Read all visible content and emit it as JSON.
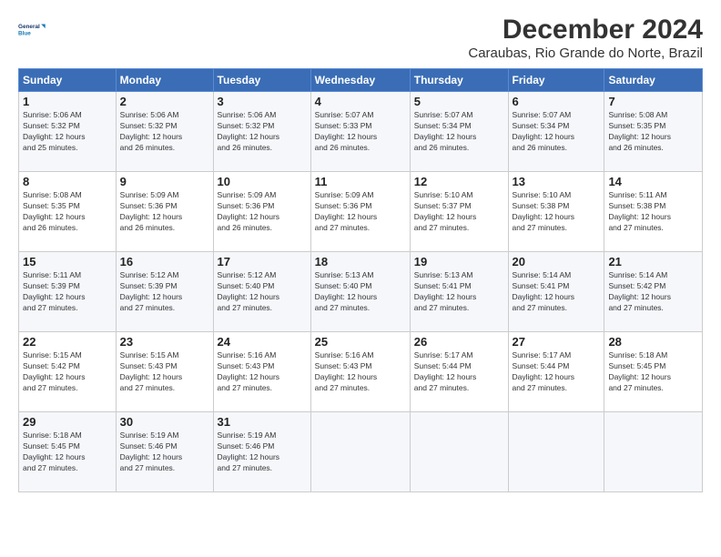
{
  "header": {
    "logo_line1": "General",
    "logo_line2": "Blue",
    "title": "December 2024",
    "subtitle": "Caraubas, Rio Grande do Norte, Brazil"
  },
  "calendar": {
    "days_of_week": [
      "Sunday",
      "Monday",
      "Tuesday",
      "Wednesday",
      "Thursday",
      "Friday",
      "Saturday"
    ],
    "weeks": [
      [
        {
          "day": "",
          "info": ""
        },
        {
          "day": "2",
          "info": "Sunrise: 5:06 AM\nSunset: 5:32 PM\nDaylight: 12 hours\nand 26 minutes."
        },
        {
          "day": "3",
          "info": "Sunrise: 5:06 AM\nSunset: 5:32 PM\nDaylight: 12 hours\nand 26 minutes."
        },
        {
          "day": "4",
          "info": "Sunrise: 5:07 AM\nSunset: 5:33 PM\nDaylight: 12 hours\nand 26 minutes."
        },
        {
          "day": "5",
          "info": "Sunrise: 5:07 AM\nSunset: 5:34 PM\nDaylight: 12 hours\nand 26 minutes."
        },
        {
          "day": "6",
          "info": "Sunrise: 5:07 AM\nSunset: 5:34 PM\nDaylight: 12 hours\nand 26 minutes."
        },
        {
          "day": "7",
          "info": "Sunrise: 5:08 AM\nSunset: 5:35 PM\nDaylight: 12 hours\nand 26 minutes."
        }
      ],
      [
        {
          "day": "8",
          "info": "Sunrise: 5:08 AM\nSunset: 5:35 PM\nDaylight: 12 hours\nand 26 minutes."
        },
        {
          "day": "9",
          "info": "Sunrise: 5:09 AM\nSunset: 5:36 PM\nDaylight: 12 hours\nand 26 minutes."
        },
        {
          "day": "10",
          "info": "Sunrise: 5:09 AM\nSunset: 5:36 PM\nDaylight: 12 hours\nand 26 minutes."
        },
        {
          "day": "11",
          "info": "Sunrise: 5:09 AM\nSunset: 5:36 PM\nDaylight: 12 hours\nand 27 minutes."
        },
        {
          "day": "12",
          "info": "Sunrise: 5:10 AM\nSunset: 5:37 PM\nDaylight: 12 hours\nand 27 minutes."
        },
        {
          "day": "13",
          "info": "Sunrise: 5:10 AM\nSunset: 5:38 PM\nDaylight: 12 hours\nand 27 minutes."
        },
        {
          "day": "14",
          "info": "Sunrise: 5:11 AM\nSunset: 5:38 PM\nDaylight: 12 hours\nand 27 minutes."
        }
      ],
      [
        {
          "day": "15",
          "info": "Sunrise: 5:11 AM\nSunset: 5:39 PM\nDaylight: 12 hours\nand 27 minutes."
        },
        {
          "day": "16",
          "info": "Sunrise: 5:12 AM\nSunset: 5:39 PM\nDaylight: 12 hours\nand 27 minutes."
        },
        {
          "day": "17",
          "info": "Sunrise: 5:12 AM\nSunset: 5:40 PM\nDaylight: 12 hours\nand 27 minutes."
        },
        {
          "day": "18",
          "info": "Sunrise: 5:13 AM\nSunset: 5:40 PM\nDaylight: 12 hours\nand 27 minutes."
        },
        {
          "day": "19",
          "info": "Sunrise: 5:13 AM\nSunset: 5:41 PM\nDaylight: 12 hours\nand 27 minutes."
        },
        {
          "day": "20",
          "info": "Sunrise: 5:14 AM\nSunset: 5:41 PM\nDaylight: 12 hours\nand 27 minutes."
        },
        {
          "day": "21",
          "info": "Sunrise: 5:14 AM\nSunset: 5:42 PM\nDaylight: 12 hours\nand 27 minutes."
        }
      ],
      [
        {
          "day": "22",
          "info": "Sunrise: 5:15 AM\nSunset: 5:42 PM\nDaylight: 12 hours\nand 27 minutes."
        },
        {
          "day": "23",
          "info": "Sunrise: 5:15 AM\nSunset: 5:43 PM\nDaylight: 12 hours\nand 27 minutes."
        },
        {
          "day": "24",
          "info": "Sunrise: 5:16 AM\nSunset: 5:43 PM\nDaylight: 12 hours\nand 27 minutes."
        },
        {
          "day": "25",
          "info": "Sunrise: 5:16 AM\nSunset: 5:43 PM\nDaylight: 12 hours\nand 27 minutes."
        },
        {
          "day": "26",
          "info": "Sunrise: 5:17 AM\nSunset: 5:44 PM\nDaylight: 12 hours\nand 27 minutes."
        },
        {
          "day": "27",
          "info": "Sunrise: 5:17 AM\nSunset: 5:44 PM\nDaylight: 12 hours\nand 27 minutes."
        },
        {
          "day": "28",
          "info": "Sunrise: 5:18 AM\nSunset: 5:45 PM\nDaylight: 12 hours\nand 27 minutes."
        }
      ],
      [
        {
          "day": "29",
          "info": "Sunrise: 5:18 AM\nSunset: 5:45 PM\nDaylight: 12 hours\nand 27 minutes."
        },
        {
          "day": "30",
          "info": "Sunrise: 5:19 AM\nSunset: 5:46 PM\nDaylight: 12 hours\nand 27 minutes."
        },
        {
          "day": "31",
          "info": "Sunrise: 5:19 AM\nSunset: 5:46 PM\nDaylight: 12 hours\nand 27 minutes."
        },
        {
          "day": "",
          "info": ""
        },
        {
          "day": "",
          "info": ""
        },
        {
          "day": "",
          "info": ""
        },
        {
          "day": "",
          "info": ""
        }
      ]
    ],
    "week1_sun": {
      "day": "1",
      "info": "Sunrise: 5:06 AM\nSunset: 5:32 PM\nDaylight: 12 hours\nand 25 minutes."
    }
  }
}
